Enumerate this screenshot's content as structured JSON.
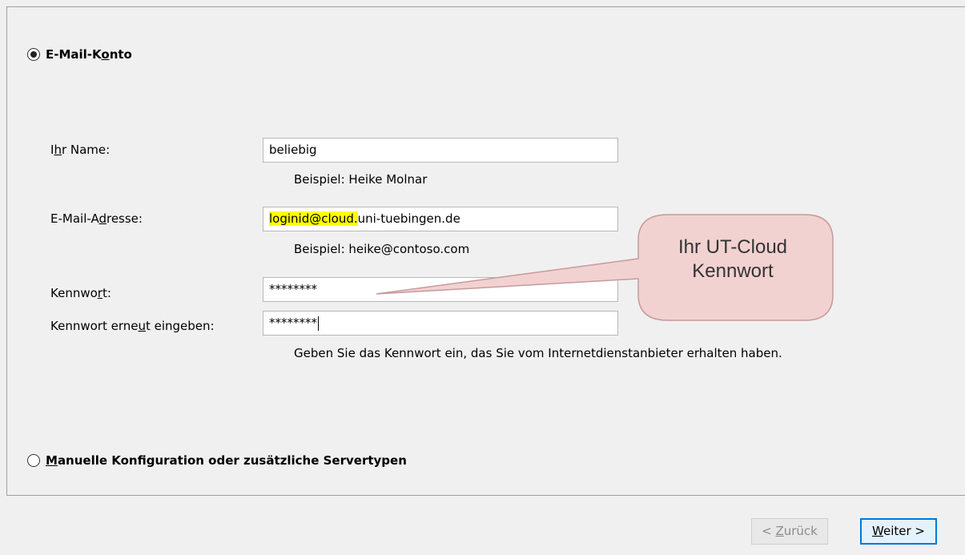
{
  "account_option": {
    "label_pre": "E-Mail-K",
    "label_ul": "o",
    "label_post": "nto",
    "checked": true
  },
  "fields": {
    "name": {
      "label_pre": "I",
      "label_ul": "h",
      "label_post": "r Name:",
      "value": "beliebig",
      "hint": "Beispiel: Heike Molnar"
    },
    "email": {
      "label_pre": "E-Mail-A",
      "label_ul": "d",
      "label_post": "resse:",
      "value_highlighted": "loginid@cloud.",
      "value_rest": "uni-tuebingen.de",
      "hint": "Beispiel: heike@contoso.com"
    },
    "password": {
      "label_pre": "Kennwo",
      "label_ul": "r",
      "label_post": "t:",
      "value": "********"
    },
    "password_confirm": {
      "label_pre": "Kennwort erne",
      "label_ul": "u",
      "label_post": "t eingeben:",
      "value": "********",
      "hint": "Geben Sie das Kennwort ein, das Sie vom Internetdienstanbieter erhalten haben."
    }
  },
  "callout": {
    "line1": "Ihr UT-Cloud",
    "line2": "Kennwort",
    "fill_color": "#f2d1d1",
    "border_color": "#c79a9a"
  },
  "manual_option": {
    "label_ul": "M",
    "label_post": "anuelle Konfiguration oder zusätzliche Servertypen",
    "checked": false
  },
  "buttons": {
    "back": {
      "label_pre": "< ",
      "label_ul": "Z",
      "label_post": "urück",
      "enabled": false
    },
    "next": {
      "label_ul": "W",
      "label_post": "eiter >",
      "enabled": true
    }
  },
  "colors": {
    "highlight": "#ffff00",
    "accent": "#0078d7"
  }
}
